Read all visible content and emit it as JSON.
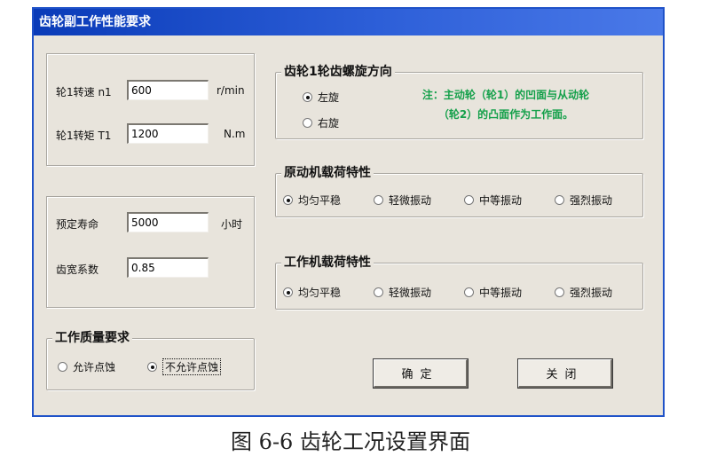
{
  "window": {
    "title": "齿轮副工作性能要求"
  },
  "load_panel": {
    "speed": {
      "label": "轮1转速 n1",
      "value": "600",
      "unit": "r/min"
    },
    "torque": {
      "label": "轮1转矩 T1",
      "value": "1200",
      "unit": "N.m"
    }
  },
  "life_panel": {
    "life": {
      "label": "预定寿命",
      "value": "5000",
      "unit": "小时"
    },
    "width": {
      "label": "齿宽系数",
      "value": "0.85"
    }
  },
  "quality_group": {
    "title": "工作质量要求",
    "options": [
      "允许点蚀",
      "不允许点蚀"
    ],
    "selected": "不允许点蚀"
  },
  "helix_group": {
    "title": "齿轮1轮齿螺旋方向",
    "options": [
      "左旋",
      "右旋"
    ],
    "selected": "左旋",
    "note_line1": "注：主动轮（轮1）的凹面与从动轮",
    "note_line2": "（轮2）的凸面作为工作面。"
  },
  "driver_group": {
    "title": "原动机载荷特性",
    "options": [
      "均匀平稳",
      "轻微振动",
      "中等振动",
      "强烈振动"
    ],
    "selected": "均匀平稳"
  },
  "machine_group": {
    "title": "工作机载荷特性",
    "options": [
      "均匀平稳",
      "轻微振动",
      "中等振动",
      "强烈振动"
    ],
    "selected": "均匀平稳"
  },
  "buttons": {
    "ok": "确定",
    "close": "关闭"
  },
  "caption": "图 6-6  齿轮工况设置界面",
  "colors": {
    "titlebar": "#1f52c8",
    "note": "#14a04a",
    "window_bg": "#e8e4dc"
  }
}
